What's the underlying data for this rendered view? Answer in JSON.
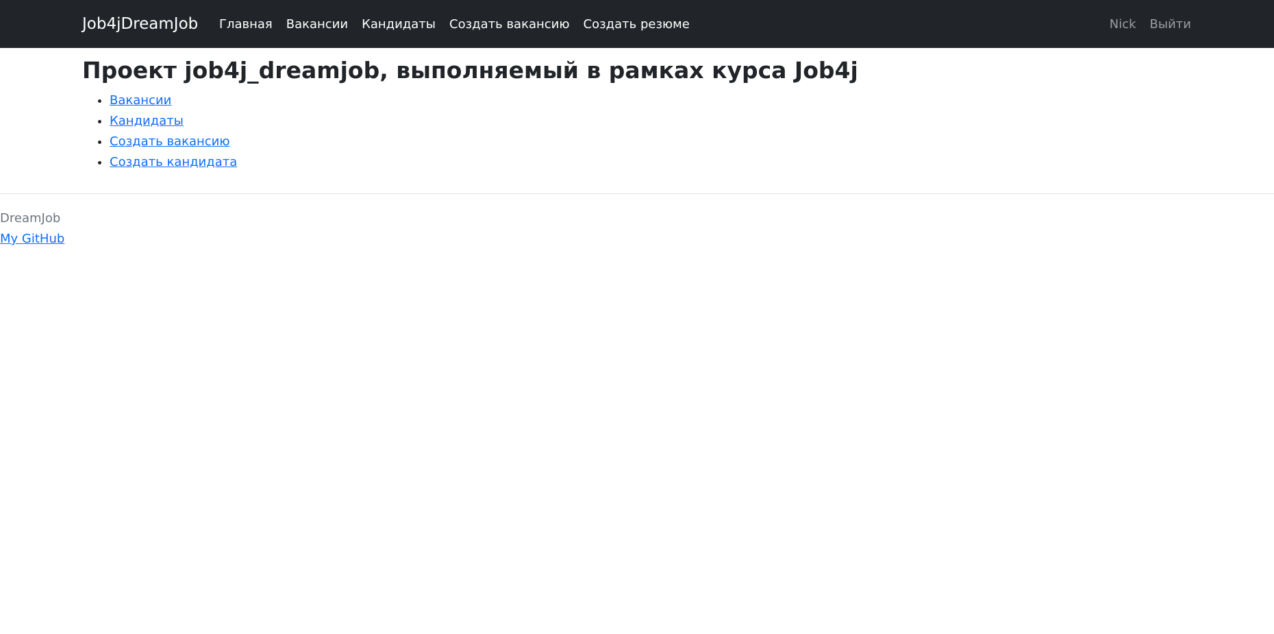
{
  "navbar": {
    "brand": "Job4jDreamJob",
    "items": [
      {
        "label": "Главная"
      },
      {
        "label": "Вакансии"
      },
      {
        "label": "Кандидаты"
      },
      {
        "label": "Создать вакансию"
      },
      {
        "label": "Создать резюме"
      }
    ],
    "user": "Nick",
    "logout": "Выйти"
  },
  "main": {
    "title": "Проект job4j_dreamjob, выполняемый в рамках курса Job4j",
    "links": [
      {
        "label": "Вакансии"
      },
      {
        "label": "Кандидаты"
      },
      {
        "label": "Создать вакансию"
      },
      {
        "label": "Создать кандидата"
      }
    ]
  },
  "footer": {
    "brand": "DreamJob",
    "github": "My GitHub"
  },
  "colors": {
    "navbar_bg": "#212529",
    "link": "#0d6efd",
    "muted": "#6c757d"
  }
}
